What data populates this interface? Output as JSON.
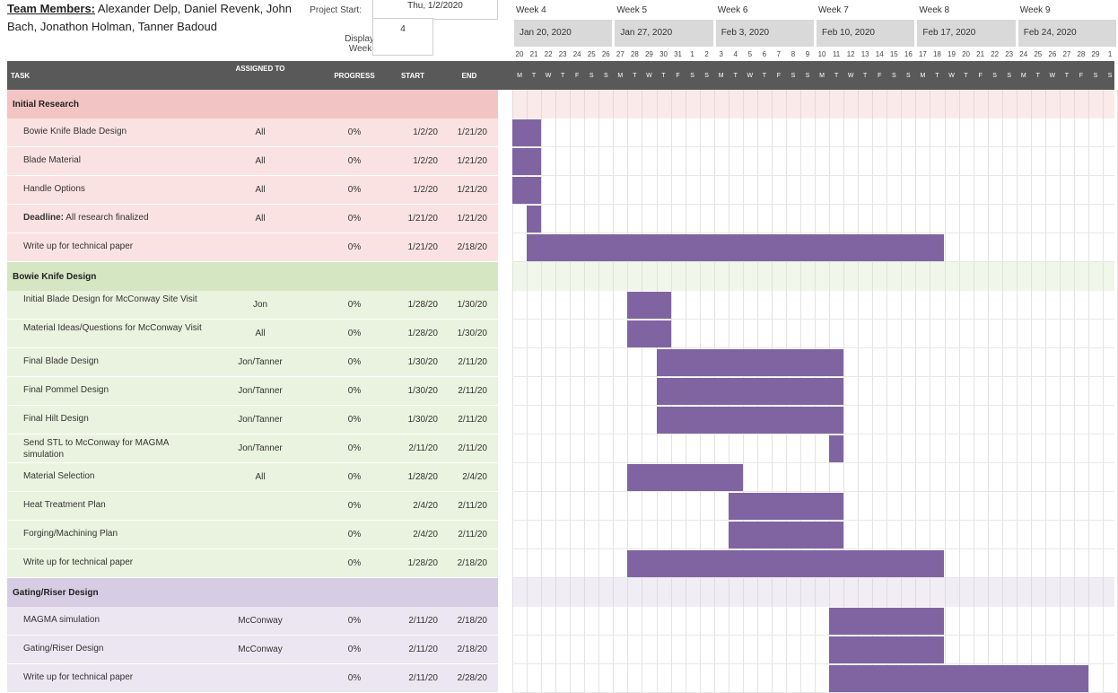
{
  "team": {
    "label": "Team Members:",
    "names": "Alexander Delp, Daniel Revenk, John Bach, Jonathon Holman, Tanner Badoud"
  },
  "project_start_label": "Project Start:",
  "project_start_value": "Thu, 1/2/2020",
  "display_week_label": "Display Week:",
  "display_week_value": "4",
  "weeks": [
    "Week 4",
    "Week 5",
    "Week 6",
    "Week 7",
    "Week 8",
    "Week 9"
  ],
  "week_dates": [
    "Jan 20, 2020",
    "Jan 27, 2020",
    "Feb 3, 2020",
    "Feb 10, 2020",
    "Feb 17, 2020",
    "Feb 24, 2020"
  ],
  "days": [
    "20",
    "21",
    "22",
    "23",
    "24",
    "25",
    "26",
    "27",
    "28",
    "29",
    "30",
    "31",
    "1",
    "2",
    "3",
    "4",
    "5",
    "6",
    "7",
    "8",
    "9",
    "10",
    "11",
    "12",
    "13",
    "14",
    "15",
    "16",
    "17",
    "18",
    "19",
    "20",
    "21",
    "22",
    "23",
    "24",
    "25",
    "26",
    "27",
    "28",
    "29",
    "1"
  ],
  "dows": [
    "M",
    "T",
    "W",
    "T",
    "F",
    "S",
    "S",
    "M",
    "T",
    "W",
    "T",
    "F",
    "S",
    "S",
    "M",
    "T",
    "W",
    "T",
    "F",
    "S",
    "S",
    "M",
    "T",
    "W",
    "T",
    "F",
    "S",
    "S",
    "M",
    "T",
    "W",
    "T",
    "F",
    "S",
    "S",
    "M",
    "T",
    "W",
    "T",
    "F",
    "S",
    "S"
  ],
  "headers": {
    "task": "TASK",
    "assigned": "ASSIGNED TO",
    "progress": "PROGRESS",
    "start": "START",
    "end": "END"
  },
  "colors": {
    "phase1": "#f2c4c4",
    "phase1_row": "#fbe2e2",
    "phase2": "#d5e6c3",
    "phase2_row": "#eaf3df",
    "phase3": "#d6cce3",
    "phase3_row": "#ebe6f1",
    "bar": "#8064a2",
    "header": "#595959"
  },
  "chart_data": {
    "type": "gantt",
    "phases": [
      {
        "name": "Initial Research",
        "tasks": [
          {
            "name": "Bowie Knife Blade Design",
            "assigned": "All",
            "progress": "0%",
            "start": "1/2/20",
            "end": "1/21/20"
          },
          {
            "name": "Blade Material",
            "assigned": "All",
            "progress": "0%",
            "start": "1/2/20",
            "end": "1/21/20"
          },
          {
            "name": "Handle Options",
            "assigned": "All",
            "progress": "0%",
            "start": "1/2/20",
            "end": "1/21/20"
          },
          {
            "name_bold": "Deadline:",
            "name": " All research finalized",
            "assigned": "All",
            "progress": "0%",
            "start": "1/21/20",
            "end": "1/21/20"
          },
          {
            "name": "Write up for technical paper",
            "assigned": "",
            "progress": "0%",
            "start": "1/21/20",
            "end": "2/18/20"
          }
        ]
      },
      {
        "name": "Bowie Knife Design",
        "tasks": [
          {
            "name": "Initial Blade Design for McConway Site Visit",
            "assigned": "Jon",
            "progress": "0%",
            "start": "1/28/20",
            "end": "1/30/20"
          },
          {
            "name": "Material Ideas/Questions for McConway Visit",
            "assigned": "All",
            "progress": "0%",
            "start": "1/28/20",
            "end": "1/30/20"
          },
          {
            "name": "Final Blade Design",
            "assigned": "Jon/Tanner",
            "progress": "0%",
            "start": "1/30/20",
            "end": "2/11/20"
          },
          {
            "name": "Final Pommel Design",
            "assigned": "Jon/Tanner",
            "progress": "0%",
            "start": "1/30/20",
            "end": "2/11/20"
          },
          {
            "name": "Final Hilt Design",
            "assigned": "Jon/Tanner",
            "progress": "0%",
            "start": "1/30/20",
            "end": "2/11/20"
          },
          {
            "name": "Send STL to McConway for MAGMA simulation",
            "assigned": "Jon/Tanner",
            "progress": "0%",
            "start": "2/11/20",
            "end": "2/11/20"
          },
          {
            "name": "Material Selection",
            "assigned": "All",
            "progress": "0%",
            "start": "1/28/20",
            "end": "2/4/20"
          },
          {
            "name": "Heat Treatment Plan",
            "assigned": "",
            "progress": "0%",
            "start": "2/4/20",
            "end": "2/11/20"
          },
          {
            "name": "Forging/Machining Plan",
            "assigned": "",
            "progress": "0%",
            "start": "2/4/20",
            "end": "2/11/20"
          },
          {
            "name": "Write up for technical paper",
            "assigned": "",
            "progress": "0%",
            "start": "1/28/20",
            "end": "2/18/20"
          }
        ]
      },
      {
        "name": "Gating/Riser Design",
        "tasks": [
          {
            "name": "MAGMA simulation",
            "assigned": "McConway",
            "progress": "0%",
            "start": "2/11/20",
            "end": "2/18/20"
          },
          {
            "name": "Gating/Riser Design",
            "assigned": "McConway",
            "progress": "0%",
            "start": "2/11/20",
            "end": "2/18/20"
          },
          {
            "name": "Write up for technical paper",
            "assigned": "",
            "progress": "0%",
            "start": "2/11/20",
            "end": "2/28/20"
          }
        ]
      }
    ]
  }
}
